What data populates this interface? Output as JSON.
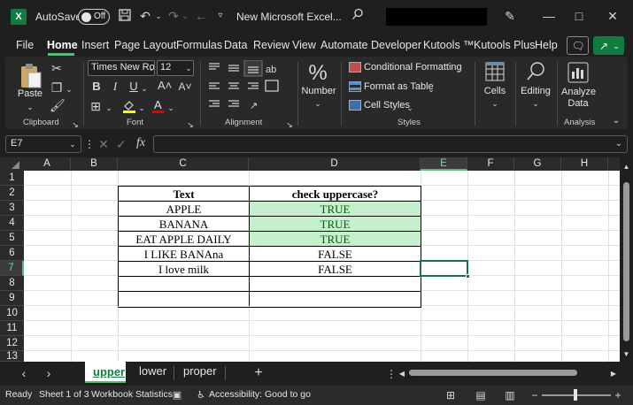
{
  "titlebar": {
    "autosave_label": "AutoSave",
    "autosave_state": "Off",
    "filename": "New Microsoft Excel...",
    "logo_letter": "X"
  },
  "tabs": [
    "File",
    "Home",
    "Insert",
    "Page Layout",
    "Formulas",
    "Data",
    "Review",
    "View",
    "Automate",
    "Developer",
    "Kutools ™",
    "Kutools Plus",
    "Help"
  ],
  "active_tab": "Home",
  "ribbon": {
    "clipboard": {
      "paste": "Paste",
      "group": "Clipboard"
    },
    "font": {
      "name": "Times New Ro",
      "size": "12",
      "group": "Font",
      "bold": "B",
      "italic": "I",
      "underline": "U"
    },
    "alignment": {
      "group": "Alignment"
    },
    "number": {
      "label": "Number",
      "glyph": "%"
    },
    "styles": {
      "conditional": "Conditional Formatting",
      "format_table": "Format as Table",
      "cell_styles": "Cell Styles",
      "group": "Styles"
    },
    "cells": {
      "label": "Cells"
    },
    "editing": {
      "label": "Editing"
    },
    "analysis": {
      "label1": "Analyze",
      "label2": "Data",
      "group": "Analysis"
    }
  },
  "formula_bar": {
    "name_box": "E7",
    "fx": "fx",
    "content": ""
  },
  "columns": [
    "A",
    "B",
    "C",
    "D",
    "E",
    "F",
    "G",
    "H"
  ],
  "selected_column": "E",
  "rows": [
    "1",
    "2",
    "3",
    "4",
    "5",
    "6",
    "7",
    "8",
    "9",
    "10",
    "11",
    "12",
    "13"
  ],
  "selected_row": "7",
  "table": {
    "headers": [
      "Text",
      "check uppercase?"
    ],
    "rows": [
      [
        "APPLE",
        "TRUE"
      ],
      [
        "BANANA",
        "TRUE"
      ],
      [
        "EAT APPLE DAILY",
        "TRUE"
      ],
      [
        "I LIKE BANAna",
        "FALSE"
      ],
      [
        "I love milk",
        "FALSE"
      ],
      [
        "",
        ""
      ],
      [
        "",
        ""
      ]
    ]
  },
  "sheets": [
    "upper",
    "lower",
    "proper"
  ],
  "active_sheet": "upper",
  "status": {
    "ready": "Ready",
    "sheet_info": "Sheet 1 of 3",
    "workbook_stats": "Workbook Statistics",
    "accessibility": "Accessibility: Good to go"
  },
  "colors": {
    "accent": "#5bb87f",
    "true_fill": "#c6efce",
    "true_text": "#006100",
    "excel_green": "#107c41"
  }
}
